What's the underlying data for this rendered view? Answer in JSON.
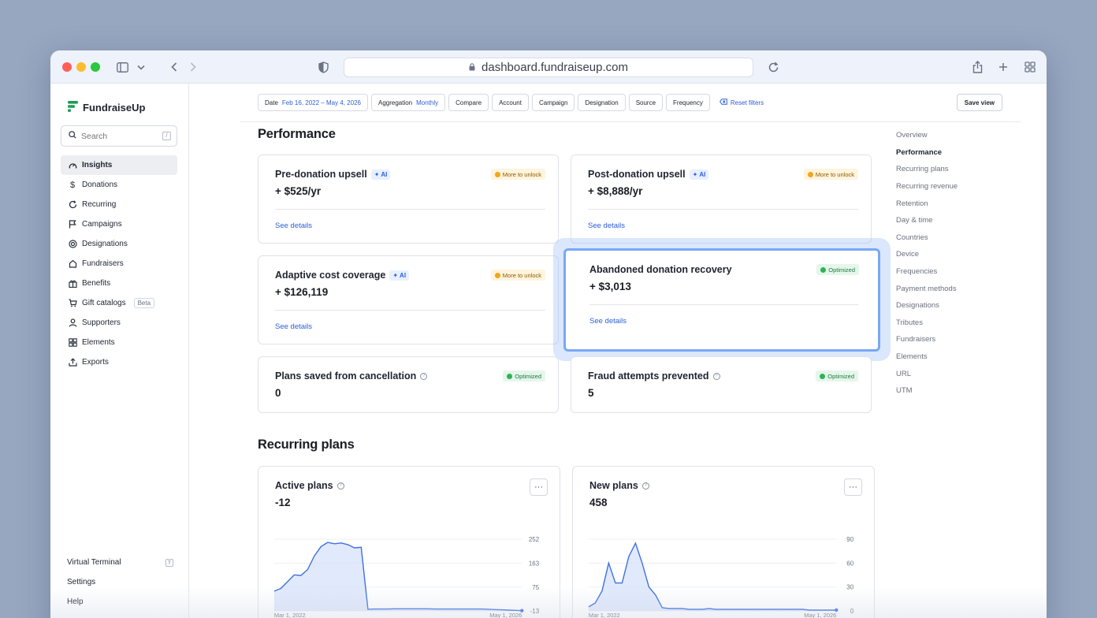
{
  "browser": {
    "url": "dashboard.fundraiseup.com"
  },
  "app": {
    "logo_text": "FundraiseUp",
    "search_placeholder": "Search",
    "search_shortcut": "/"
  },
  "sidebar": {
    "items": [
      {
        "label": "Insights",
        "icon": "gauge-icon",
        "active": true
      },
      {
        "label": "Donations",
        "icon": "dollar-icon"
      },
      {
        "label": "Recurring",
        "icon": "refresh-icon"
      },
      {
        "label": "Campaigns",
        "icon": "flag-icon"
      },
      {
        "label": "Designations",
        "icon": "target-icon"
      },
      {
        "label": "Fundraisers",
        "icon": "house-icon"
      },
      {
        "label": "Benefits",
        "icon": "gift-icon"
      },
      {
        "label": "Gift catalogs",
        "icon": "cart-icon",
        "badge": "Beta"
      },
      {
        "label": "Supporters",
        "icon": "person-icon"
      },
      {
        "label": "Elements",
        "icon": "grid-icon"
      },
      {
        "label": "Exports",
        "icon": "upload-icon"
      }
    ],
    "bottom": {
      "virtual_terminal": "Virtual Terminal",
      "virtual_terminal_shortcut": "T",
      "settings": "Settings",
      "help": "Help"
    }
  },
  "filters": {
    "date_label": "Date",
    "date_value": "Feb 16, 2022 – May 4, 2026",
    "aggregation_label": "Aggregation",
    "aggregation_value": "Monthly",
    "compare": "Compare",
    "account": "Account",
    "campaign": "Campaign",
    "designation": "Designation",
    "source": "Source",
    "frequency": "Frequency",
    "reset": "Reset filters",
    "save_view": "Save view"
  },
  "performance": {
    "title": "Performance",
    "ai_label": "AI",
    "see_details": "See details",
    "cards": [
      {
        "title": "Pre-donation upsell",
        "value": "+ $525/yr",
        "status": "More to unlock",
        "ai": true
      },
      {
        "title": "Post-donation upsell",
        "value": "+ $8,888/yr",
        "status": "More to unlock",
        "ai": true
      },
      {
        "title": "Adaptive cost coverage",
        "value": "+ $126,119",
        "status": "More to unlock",
        "ai": true
      },
      {
        "title": "Abandoned donation recovery",
        "value": "+ $3,013",
        "status": "Optimized",
        "ai": false
      },
      {
        "title": "Plans saved from cancellation",
        "value": "0",
        "status": "Optimized",
        "info": true
      },
      {
        "title": "Fraud attempts prevented",
        "value": "5",
        "status": "Optimized",
        "info": true
      }
    ]
  },
  "recurring_plans": {
    "title": "Recurring plans",
    "cards": [
      {
        "title": "Active plans",
        "value": "-12"
      },
      {
        "title": "New plans",
        "value": "458"
      }
    ]
  },
  "right_nav": {
    "items": [
      "Overview",
      "Performance",
      "Recurring plans",
      "Recurring revenue",
      "Retention",
      "Day & time",
      "Countries",
      "Device",
      "Frequencies",
      "Payment methods",
      "Designations",
      "Tributes",
      "Fundraisers",
      "Elements",
      "URL",
      "UTM"
    ],
    "active_index": 1
  },
  "chart_data": [
    {
      "type": "area",
      "x_start_label": "Mar 1, 2022",
      "x_end_label": "May 1, 2026",
      "yticks": [
        252,
        163,
        75,
        -13
      ],
      "ylim": [
        -13,
        252
      ],
      "values": [
        60,
        70,
        95,
        120,
        118,
        140,
        190,
        225,
        240,
        235,
        238,
        232,
        220,
        222,
        -7,
        -6,
        -6,
        -6,
        -5,
        -5,
        -5,
        -5,
        -5,
        -5,
        -6,
        -6,
        -6,
        -6,
        -6,
        -6,
        -6,
        -6,
        -7,
        -8,
        -9,
        -10,
        -11,
        -12
      ],
      "series_color": "#3f6fe0"
    },
    {
      "type": "area",
      "x_start_label": "Mar 1, 2022",
      "x_end_label": "May 1, 2026",
      "yticks": [
        90,
        60,
        30,
        0
      ],
      "ylim": [
        0,
        90
      ],
      "values": [
        5,
        10,
        25,
        60,
        35,
        35,
        68,
        85,
        60,
        30,
        20,
        4,
        3,
        3,
        3,
        2,
        2,
        2,
        3,
        2,
        2,
        2,
        2,
        2,
        2,
        2,
        2,
        2,
        2,
        2,
        2,
        2,
        2,
        1,
        1,
        1,
        1,
        1
      ],
      "series_color": "#3f6fe0"
    }
  ]
}
